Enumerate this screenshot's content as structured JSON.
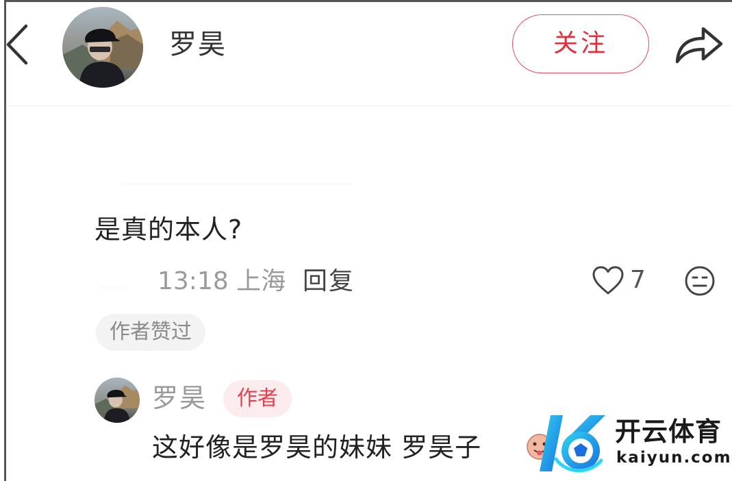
{
  "header": {
    "title": "罗昊",
    "follow_label": "关注",
    "icons": {
      "back": "back-chevron-icon",
      "share": "share-arrow-icon",
      "avatar": "user-avatar"
    }
  },
  "comment": {
    "text": "是真的本人?",
    "meta": "13:18 上海",
    "reply_label": "回复",
    "like_count": "7",
    "author_liked_tag": "作者赞过",
    "icons": {
      "like": "heart-outline-icon",
      "dislike": "meh-face-icon"
    }
  },
  "reply": {
    "name": "罗昊",
    "badge": "作者",
    "text": "这好像是罗昊的妹妹 罗昊子",
    "icons": {
      "emoji": "tongue-face-emoji-icon"
    }
  },
  "watermark": {
    "brand": "开云体育",
    "domain": "kaiyun.com",
    "icon": "kaiyun-logo-icon"
  },
  "colors": {
    "accent": "#e02e3e",
    "badge_bg": "#fdecee",
    "tag_bg": "#f3f3f3",
    "secondary_text": "#9a9a9a"
  }
}
